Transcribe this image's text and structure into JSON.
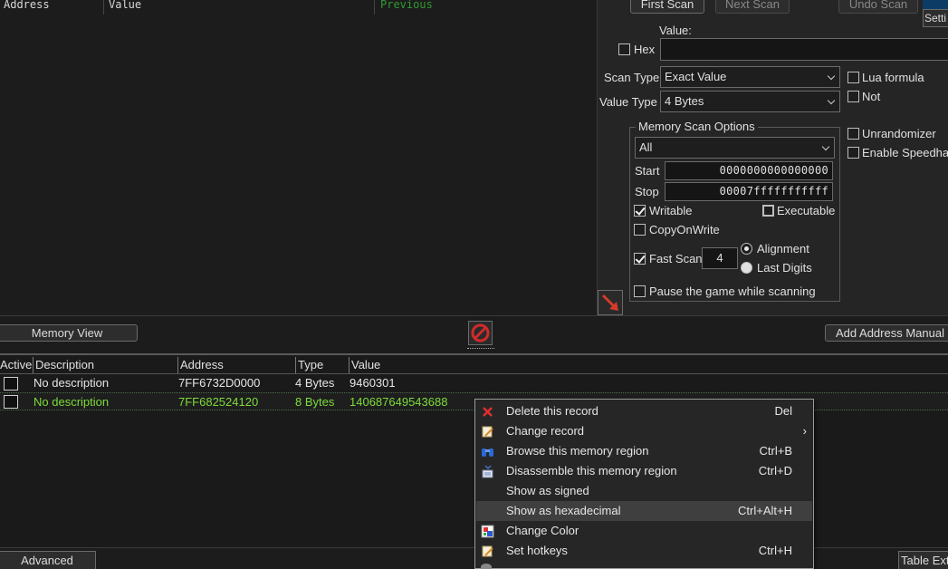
{
  "results": {
    "headers": [
      "Address",
      "Value",
      "Previous"
    ]
  },
  "scan": {
    "first_scan": "First Scan",
    "next_scan": "Next Scan",
    "undo_scan": "Undo Scan",
    "settings": "Setti",
    "value_label": "Value:",
    "hex_label": "Hex",
    "value_input": "",
    "scan_type_label": "Scan Type",
    "scan_type_value": "Exact Value",
    "value_type_label": "Value Type",
    "value_type_value": "4 Bytes",
    "lua_formula": "Lua formula",
    "not_label": "Not",
    "unrandomizer": "Unrandomizer",
    "speedhack": "Enable Speedha"
  },
  "memory_options": {
    "title": "Memory Scan Options",
    "region": "All",
    "start_label": "Start",
    "start_value": "0000000000000000",
    "stop_label": "Stop",
    "stop_value": "00007fffffffffff",
    "writable": "Writable",
    "executable": "Executable",
    "copy_on_write": "CopyOnWrite",
    "fast_scan": "Fast Scan",
    "fast_scan_value": "4",
    "alignment": "Alignment",
    "last_digits": "Last Digits",
    "pause_game": "Pause the game while scanning"
  },
  "midbar": {
    "memory_view": "Memory View",
    "add_address": "Add Address Manual"
  },
  "address_list": {
    "headers": [
      "Active",
      "Description",
      "Address",
      "Type",
      "Value"
    ],
    "rows": [
      {
        "description": "No description",
        "address": "7FF6732D0000",
        "type": "4 Bytes",
        "value": "9460301"
      },
      {
        "description": "No description",
        "address": "7FF682524120",
        "type": "8 Bytes",
        "value": "140687649543688"
      }
    ]
  },
  "bottombar": {
    "advanced": "Advanced Options",
    "table_extras": "Table Ext"
  },
  "context_menu": {
    "items": [
      {
        "label": "Delete this record",
        "shortcut": "Del",
        "icon": "delete-icon"
      },
      {
        "label": "Change record",
        "shortcut": "",
        "icon": "edit-icon"
      },
      {
        "label": "Browse this memory region",
        "shortcut": "Ctrl+B",
        "icon": "binoculars-icon"
      },
      {
        "label": "Disassemble this memory region",
        "shortcut": "Ctrl+D",
        "icon": "disassemble-icon"
      },
      {
        "label": "Show as signed",
        "shortcut": "",
        "icon": ""
      },
      {
        "label": "Show as hexadecimal",
        "shortcut": "Ctrl+Alt+H",
        "icon": ""
      },
      {
        "label": "Change Color",
        "shortcut": "",
        "icon": "color-icon"
      },
      {
        "label": "Set hotkeys",
        "shortcut": "Ctrl+H",
        "icon": "hotkey-icon"
      }
    ]
  },
  "colors": {
    "frozen_row": "#7ddc3a",
    "previous_header": "#2f9a2f",
    "delete_red": "#e03030"
  }
}
